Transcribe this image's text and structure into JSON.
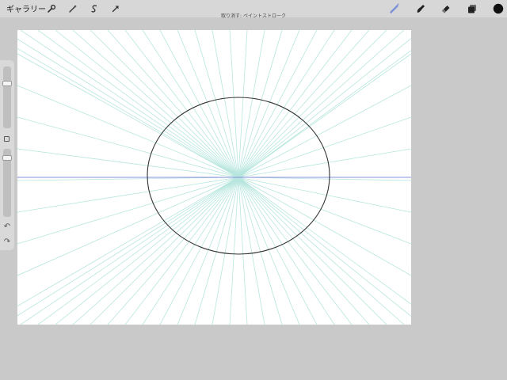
{
  "toolbar": {
    "gallery_label": "ギャラリー",
    "left_tools": [
      "wrench-icon",
      "magic-wand-icon",
      "selection-icon",
      "transform-arrow-icon"
    ],
    "right_tools": [
      "brush-icon",
      "smudge-icon",
      "eraser-icon",
      "layers-icon"
    ],
    "active_tool": "brush-icon",
    "active_color": "#111111",
    "accent_color": "#7b8fd6"
  },
  "undo_notice": "取り消す: ペイントストローク",
  "sidebar": {
    "brush_size_level": 0.25,
    "opacity_level": 0.25,
    "undo_icon": "undo-icon",
    "redo_icon": "redo-icon"
  },
  "canvas": {
    "background": "#ffffff",
    "guide": {
      "type": "perspective-one-point",
      "horizon_color": "#8a8fe0",
      "ray_color": "#b7e6de"
    },
    "ellipse_stroke": "#333333"
  }
}
